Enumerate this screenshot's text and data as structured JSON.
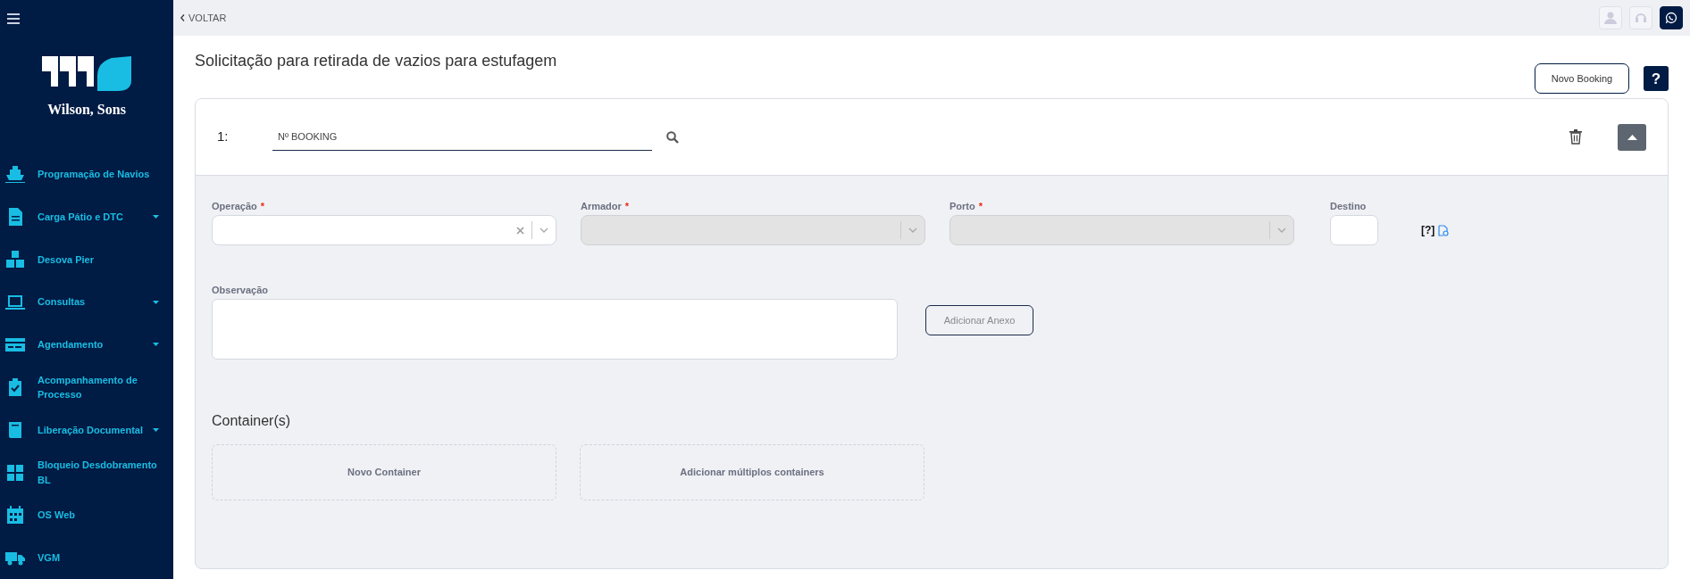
{
  "sidebar": {
    "logo_text": "Wilson, Sons",
    "items": [
      {
        "label": "Programação de Navios",
        "has_submenu": false
      },
      {
        "label": "Carga Pátio e DTC",
        "has_submenu": true
      },
      {
        "label": "Desova Pier",
        "has_submenu": false
      },
      {
        "label": "Consultas",
        "has_submenu": true
      },
      {
        "label": "Agendamento",
        "has_submenu": true
      },
      {
        "label": "Acompanhamento de Processo",
        "has_submenu": false
      },
      {
        "label": "Liberação Documental",
        "has_submenu": true
      },
      {
        "label": "Bloqueio Desdobramento BL",
        "has_submenu": false
      },
      {
        "label": "OS Web",
        "has_submenu": false
      },
      {
        "label": "VGM",
        "has_submenu": false
      }
    ]
  },
  "topbar": {
    "back_label": "VOLTAR"
  },
  "page": {
    "title": "Solicitação para retirada de vazios para estufagem",
    "new_booking_button": "Novo Booking",
    "help_button": "?"
  },
  "booking": {
    "index": "1:",
    "placeholder": "Nº BOOKING",
    "fields": [
      {
        "kind": "select",
        "label": "Operação",
        "required_mark": "*",
        "disabled": false,
        "clearable": true
      },
      {
        "kind": "select",
        "label": "Armador",
        "required_mark": "*",
        "disabled": true,
        "clearable": false
      },
      {
        "kind": "select",
        "label": "Porto",
        "required_mark": "*",
        "disabled": true,
        "clearable": false
      },
      {
        "kind": "text",
        "label": "Destino",
        "disabled": false
      }
    ],
    "destino_help": "[?]",
    "observation_label": "Observação",
    "attach_button": "Adicionar Anexo",
    "containers_title": "Container(s)",
    "container_actions": [
      "Novo Container",
      "Adicionar múltiplos containers"
    ]
  }
}
